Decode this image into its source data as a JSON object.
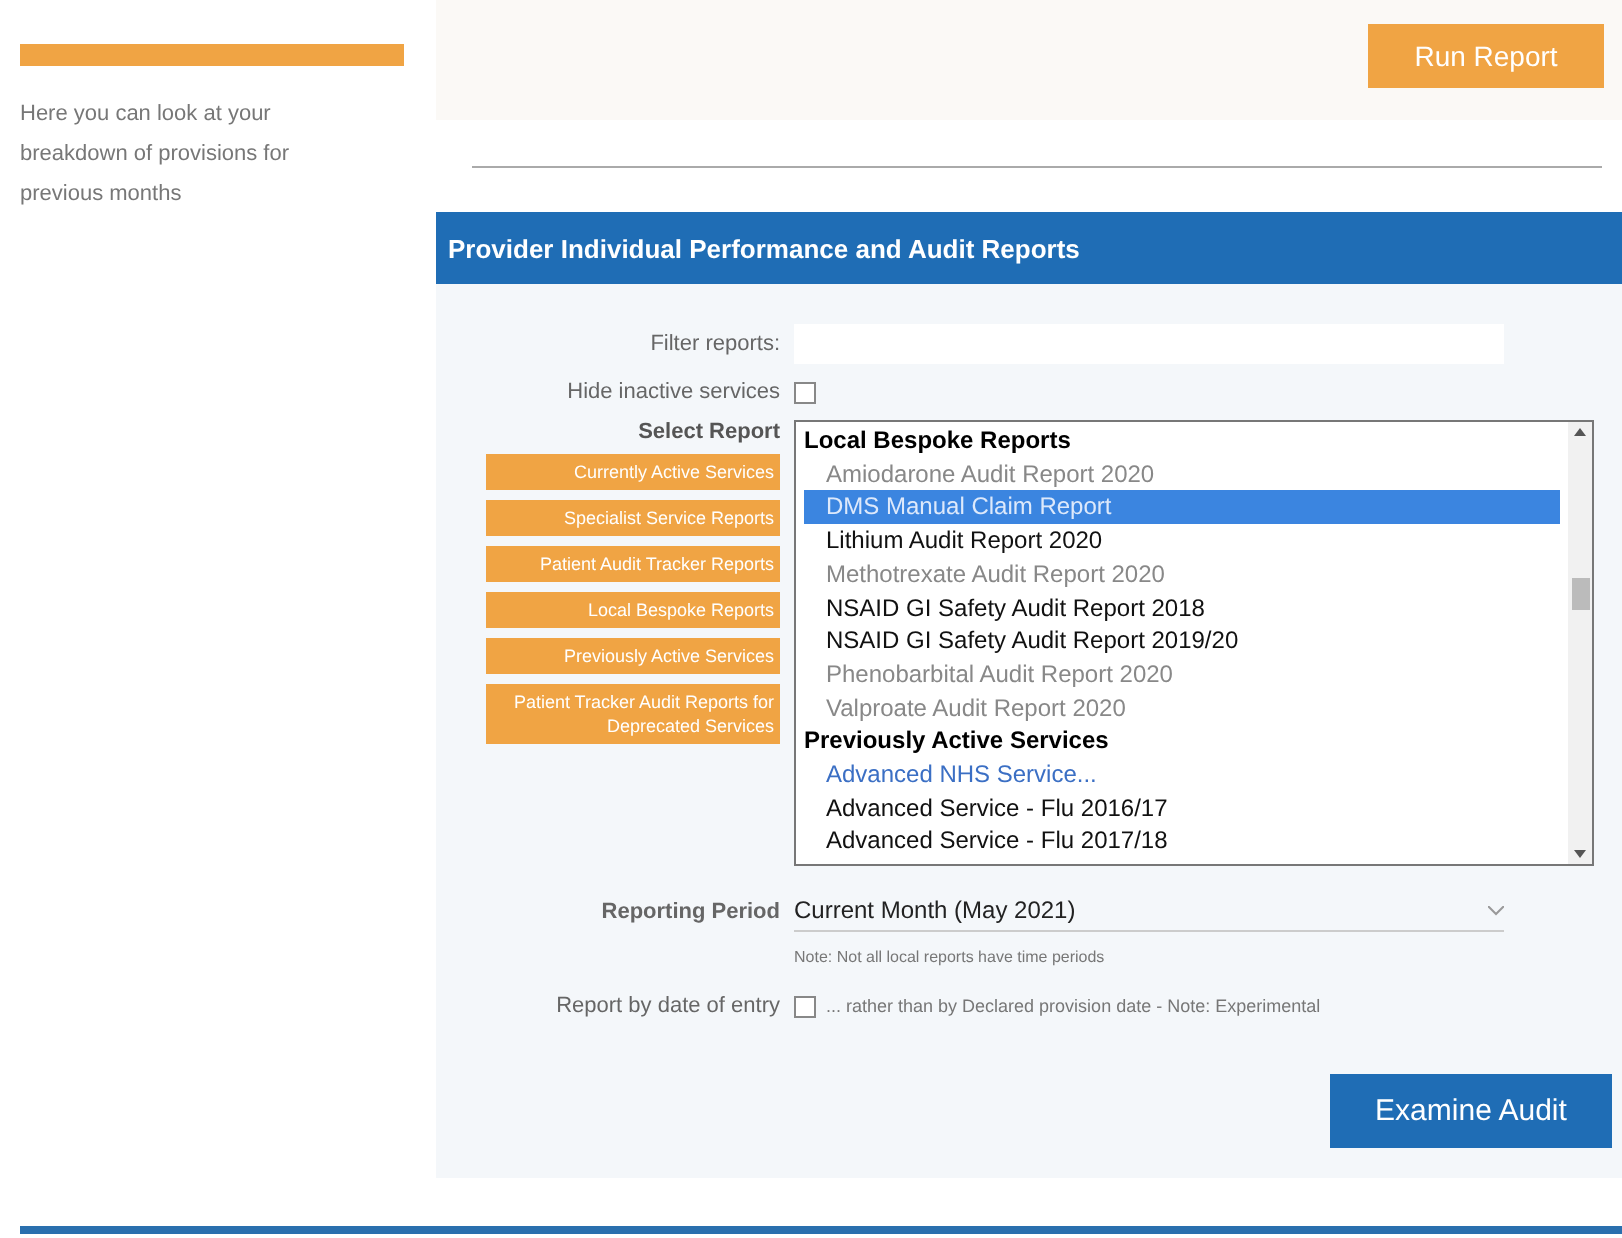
{
  "sidebar": {
    "text": "Here you can look at your breakdown of provisions for previous months"
  },
  "top_card": {
    "button": "Run Report"
  },
  "panel": {
    "title": "Provider Individual Performance and Audit Reports",
    "filter": {
      "label": "Filter reports:"
    },
    "hide_inactive": {
      "label": "Hide inactive services",
      "checked": false
    },
    "select_report": {
      "label": "Select Report",
      "categories": [
        "Currently Active Services",
        "Specialist Service Reports",
        "Patient Audit Tracker Reports",
        "Local Bespoke Reports",
        "Previously Active Services",
        "Patient Tracker Audit Reports for Deprecated Services"
      ],
      "options": [
        {
          "kind": "group",
          "label": "Local Bespoke Reports"
        },
        {
          "kind": "option",
          "label": "Amiodarone Audit Report 2020",
          "disabled": true,
          "selected": false
        },
        {
          "kind": "option",
          "label": "DMS Manual Claim Report",
          "disabled": false,
          "selected": true
        },
        {
          "kind": "option",
          "label": "Lithium Audit Report 2020",
          "disabled": false,
          "selected": false
        },
        {
          "kind": "option",
          "label": "Methotrexate Audit Report 2020",
          "disabled": true,
          "selected": false
        },
        {
          "kind": "option",
          "label": "NSAID GI Safety Audit Report 2018",
          "disabled": false,
          "selected": false
        },
        {
          "kind": "option",
          "label": "NSAID GI Safety Audit Report 2019/20",
          "disabled": false,
          "selected": false
        },
        {
          "kind": "option",
          "label": "Phenobarbital Audit Report 2020",
          "disabled": true,
          "selected": false
        },
        {
          "kind": "option",
          "label": "Valproate Audit Report 2020",
          "disabled": true,
          "selected": false
        },
        {
          "kind": "group",
          "label": "Previously Active Services"
        },
        {
          "kind": "link",
          "label": "Advanced NHS Service..."
        },
        {
          "kind": "option",
          "label": "Advanced Service - Flu 2016/17",
          "disabled": false,
          "selected": false
        },
        {
          "kind": "option",
          "label": "Advanced Service - Flu 2017/18",
          "disabled": false,
          "selected": false
        }
      ]
    },
    "period": {
      "label": "Reporting Period",
      "value": "Current Month (May 2021)",
      "note": "Note: Not all local reports have time periods"
    },
    "by_entry": {
      "label": "Report by date of entry",
      "checked": false,
      "text": "... rather than by Declared provision date - Note: Experimental"
    },
    "button": "Examine Audit"
  }
}
